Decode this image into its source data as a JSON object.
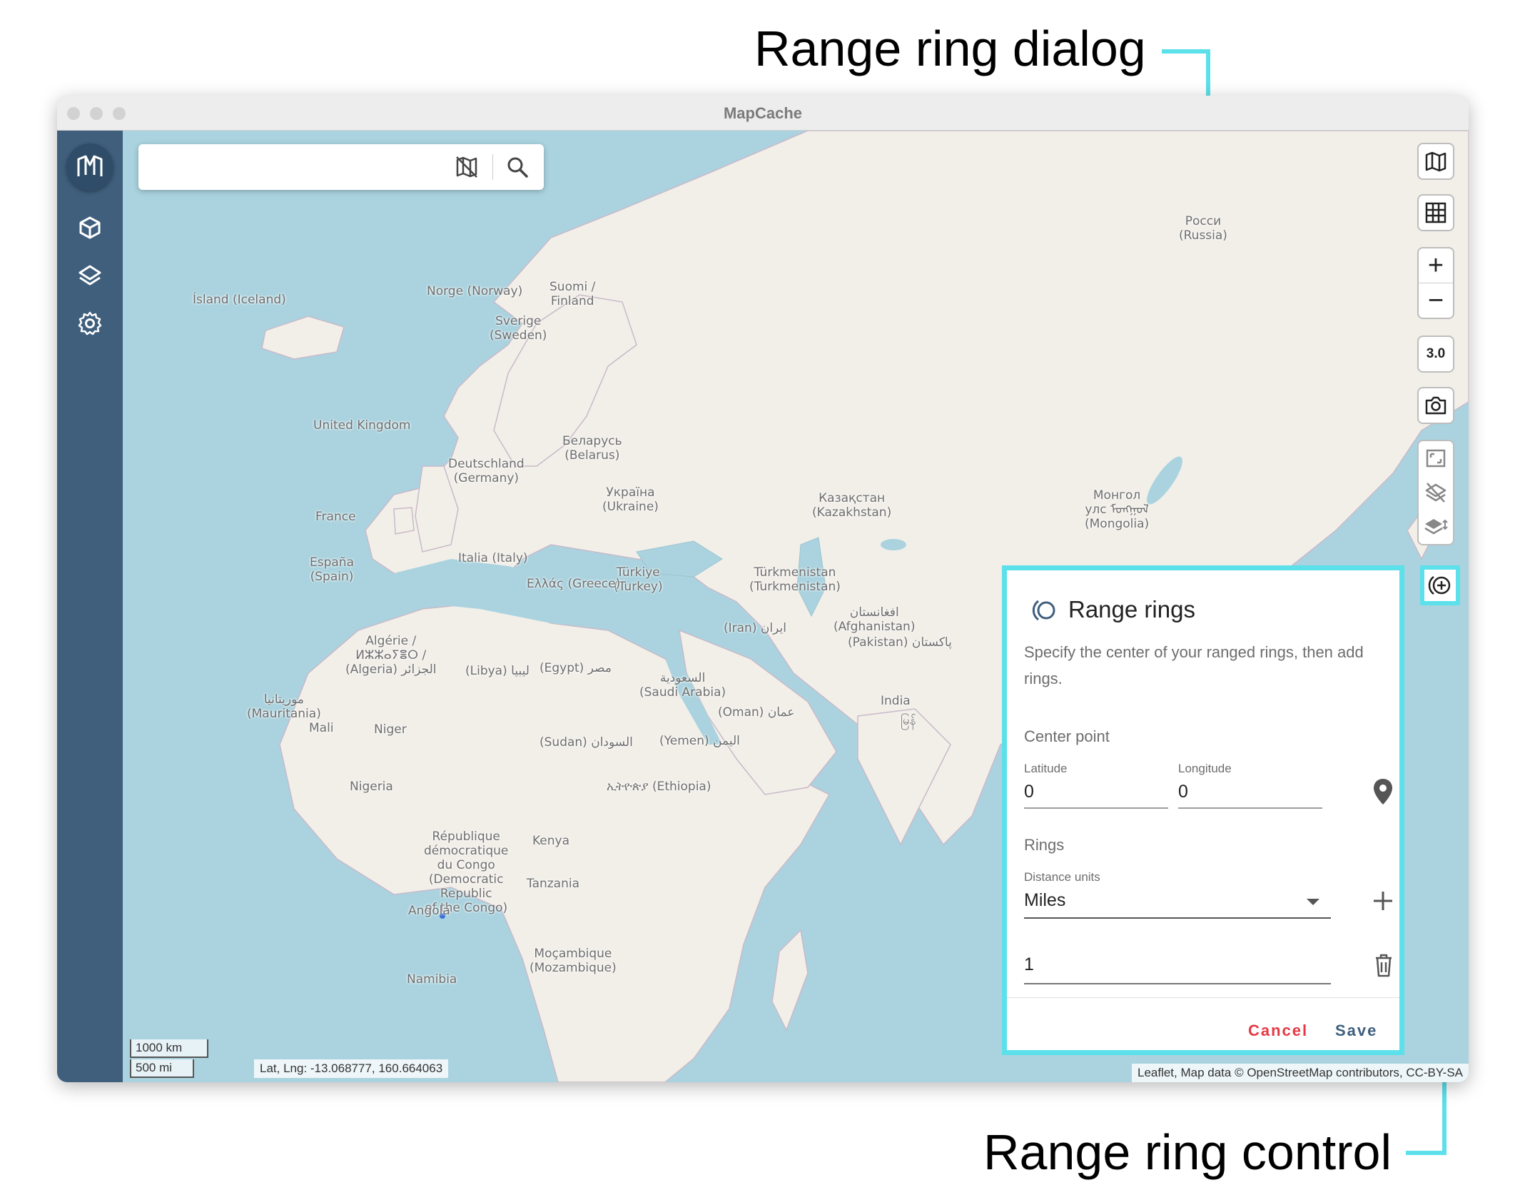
{
  "annotations": {
    "dialog_callout": "Range ring dialog",
    "control_callout": "Range ring control"
  },
  "window": {
    "title": "MapCache"
  },
  "sidebar": {
    "items": [
      {
        "icon": "geopackage-icon"
      },
      {
        "icon": "layers-icon"
      },
      {
        "icon": "settings-icon"
      }
    ]
  },
  "search": {
    "placeholder": "",
    "value": ""
  },
  "controls": {
    "zoom_level": "3.0",
    "zoom_in": "+",
    "zoom_out": "−"
  },
  "map_labels": [
    {
      "text": "Ísland (Iceland)"
    },
    {
      "text": "Norge (Norway)"
    },
    {
      "text": "Suomi /\nFinland"
    },
    {
      "text": "Sverige\n(Sweden)"
    },
    {
      "text": "Росси\n(Russia)"
    },
    {
      "text": "United Kingdom"
    },
    {
      "text": "Беларусь\n(Belarus)"
    },
    {
      "text": "Deutschland\n(Germany)"
    },
    {
      "text": "Україна\n(Ukraine)"
    },
    {
      "text": "Казақстан\n(Kazakhstan)"
    },
    {
      "text": "Монгол\nулс ᠮᠣᠩᠭᠣᠯ\n(Mongolia)"
    },
    {
      "text": "France"
    },
    {
      "text": "España\n(Spain)"
    },
    {
      "text": "Italia (Italy)"
    },
    {
      "text": "Türkiye\n(Turkey)"
    },
    {
      "text": "Ελλάς (Greece)"
    },
    {
      "text": "Türkmenistan\n(Turkmenistan)"
    },
    {
      "text": "افغانستان\n(Afghanistan)"
    },
    {
      "text": "(Iran) ایران"
    },
    {
      "text": "(Pakistan) پاکستان"
    },
    {
      "text": "Algérie /\nⵍⵣⵣⴰⵢⴻⵔ /\n(Algeria) الجزائر"
    },
    {
      "text": "(Libya) ليبيا"
    },
    {
      "text": "(Egypt) مصر"
    },
    {
      "text": "السعودية\n(Saudi Arabia)"
    },
    {
      "text": "India"
    },
    {
      "text": "موريتانيا\n(Mauritania)"
    },
    {
      "text": "(Oman) عمان"
    },
    {
      "text": "Mali"
    },
    {
      "text": "Niger"
    },
    {
      "text": "(Sudan) السودان"
    },
    {
      "text": "(Yemen) اليمن"
    },
    {
      "text": "Nigeria"
    },
    {
      "text": "ኢትዮጵያ (Ethiopia)"
    },
    {
      "text": "République\ndémocratique\ndu Congo\n(Democratic\nRepublic\nof the Congo)"
    },
    {
      "text": "Kenya"
    },
    {
      "text": "Tanzania"
    },
    {
      "text": "Angola"
    },
    {
      "text": "Moçambique\n(Mozambique)"
    },
    {
      "text": "Namibia"
    },
    {
      "text": "မြန်"
    }
  ],
  "scale": {
    "km": "1000 km",
    "mi": "500 mi"
  },
  "coords": "Lat, Lng: -13.068777, 160.664063",
  "attribution": "Leaflet, Map data © OpenStreetMap contributors, CC-BY-SA",
  "dialog": {
    "title": "Range rings",
    "description": "Specify the center of your ranged rings, then add rings.",
    "center_section": "Center point",
    "latitude_label": "Latitude",
    "latitude_value": "0",
    "longitude_label": "Longitude",
    "longitude_value": "0",
    "rings_section": "Rings",
    "units_label": "Distance units",
    "units_value": "Miles",
    "ring_value": "1",
    "cancel": "Cancel",
    "save": "Save"
  },
  "colors": {
    "accent": "#5ce0ea",
    "sidebar": "#3f5f7d",
    "sea": "#aad3df",
    "land": "#f2efe9",
    "cancel": "#e53945",
    "save": "#3f5f7d"
  }
}
